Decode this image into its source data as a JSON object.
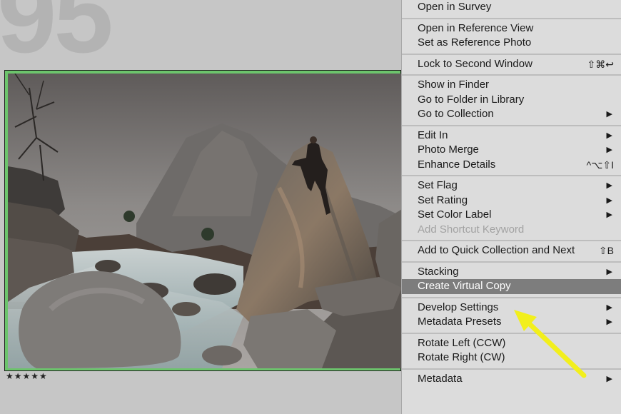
{
  "grid": {
    "cell_index": "95",
    "rating": "★★★★★"
  },
  "menu": {
    "groups": [
      {
        "items": [
          {
            "label": "Open in Survey"
          }
        ]
      },
      {
        "items": [
          {
            "label": "Open in Reference View"
          },
          {
            "label": "Set as Reference Photo"
          }
        ]
      },
      {
        "items": [
          {
            "label": "Lock to Second Window",
            "shortcut": "⇧⌘↩"
          }
        ]
      },
      {
        "items": [
          {
            "label": "Show in Finder"
          },
          {
            "label": "Go to Folder in Library"
          },
          {
            "label": "Go to Collection",
            "submenu": "▶"
          }
        ]
      },
      {
        "items": [
          {
            "label": "Edit In",
            "submenu": "▶"
          },
          {
            "label": "Photo Merge",
            "submenu": "▶"
          },
          {
            "label": "Enhance Details",
            "shortcut": "^⌥⇧I"
          }
        ]
      },
      {
        "items": [
          {
            "label": "Set Flag",
            "submenu": "▶"
          },
          {
            "label": "Set Rating",
            "submenu": "▶"
          },
          {
            "label": "Set Color Label",
            "submenu": "▶"
          },
          {
            "label": "Add Shortcut Keyword",
            "disabled": true
          }
        ]
      },
      {
        "items": [
          {
            "label": "Add to Quick Collection and Next",
            "shortcut": "⇧B"
          }
        ]
      },
      {
        "items": [
          {
            "label": "Stacking",
            "submenu": "▶"
          },
          {
            "label": "Create Virtual Copy",
            "highlighted": true
          }
        ]
      },
      {
        "items": [
          {
            "label": "Develop Settings",
            "submenu": "▶"
          },
          {
            "label": "Metadata Presets",
            "submenu": "▶"
          }
        ]
      },
      {
        "items": [
          {
            "label": "Rotate Left (CCW)"
          },
          {
            "label": "Rotate Right (CW)"
          }
        ]
      },
      {
        "items": [
          {
            "label": "Metadata",
            "submenu": "▶"
          }
        ]
      }
    ]
  },
  "colors": {
    "thumbnail_border": "#6cc46c",
    "menu_highlight": "#7d7d7d",
    "annotation_arrow": "#f2ef1c"
  },
  "icons": {
    "annotation": "yellow-arrow-pointer",
    "submenu": "chevron-right-icon"
  }
}
